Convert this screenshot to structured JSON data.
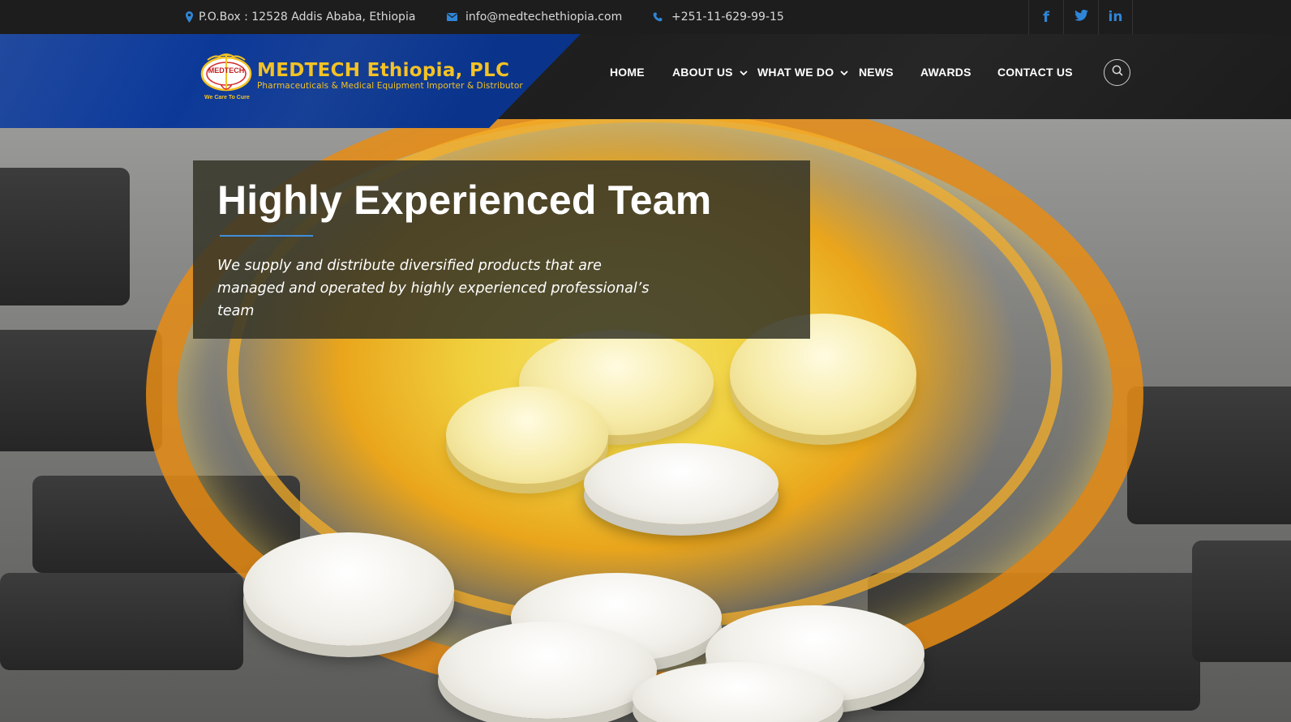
{
  "topbar": {
    "address": "P.O.Box : 12528 Addis Ababa, Ethiopia",
    "email": "info@medtechethiopia.com",
    "phone": "+251-11-629-99-15",
    "social": [
      {
        "icon": "facebook-icon",
        "glyph": "f"
      },
      {
        "icon": "twitter-icon",
        "glyph": ""
      },
      {
        "icon": "linkedin-icon",
        "glyph": "in"
      }
    ]
  },
  "brand": {
    "name": "MEDTECH Ethiopia, PLC",
    "subtitle": "Pharmaceuticals & Medical Equipment Importer & Distributor",
    "tagline": "We Care To Cure",
    "mark_text": "MEDTECH",
    "colors": {
      "panel": "#0d3a9a",
      "gold": "#f4c224",
      "accent": "#3f8ede"
    }
  },
  "nav": {
    "items": [
      {
        "label": "HOME",
        "dropdown": false
      },
      {
        "label": "ABOUT US",
        "dropdown": true
      },
      {
        "label": "WHAT WE DO",
        "dropdown": true
      },
      {
        "label": "NEWS",
        "dropdown": false
      },
      {
        "label": "AWARDS",
        "dropdown": false
      },
      {
        "label": "CONTACT US",
        "dropdown": false
      }
    ],
    "search_icon": "search-icon"
  },
  "hero": {
    "title": "Highly Experienced Team",
    "text": "We supply and distribute diversified products that are managed and operated by highly experienced professional’s team"
  }
}
